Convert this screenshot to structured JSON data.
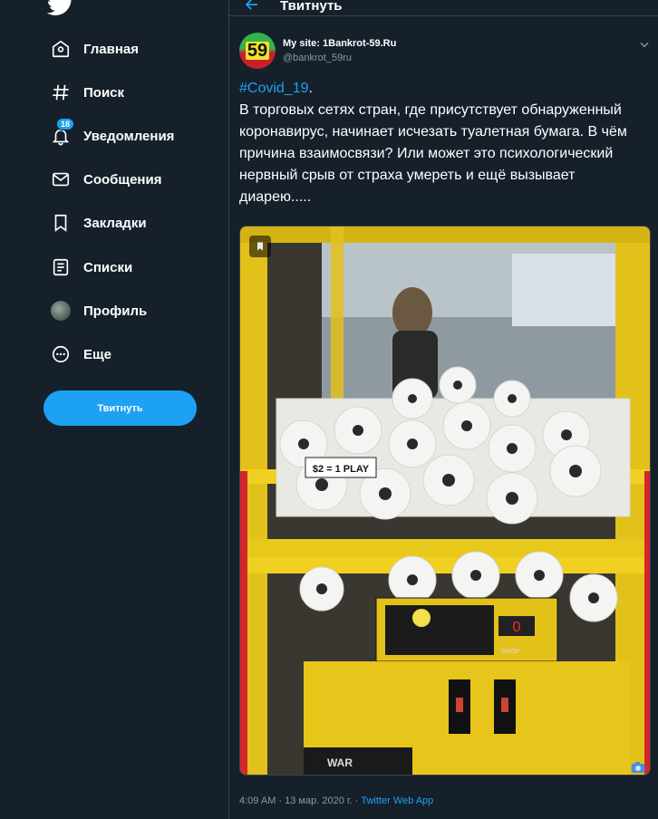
{
  "app": {
    "accent": "#1da1f2",
    "background": "#15202b",
    "muted": "#8899a6",
    "divider": "#38444d"
  },
  "sidebar": {
    "logo_icon": "twitter-bird-icon",
    "items": [
      {
        "label": "Главная",
        "icon": "home-icon"
      },
      {
        "label": "Поиск",
        "icon": "hashtag-icon"
      },
      {
        "label": "Уведомления",
        "icon": "bell-icon",
        "badge": "18"
      },
      {
        "label": "Сообщения",
        "icon": "envelope-icon"
      },
      {
        "label": "Закладки",
        "icon": "bookmark-icon"
      },
      {
        "label": "Списки",
        "icon": "list-icon"
      },
      {
        "label": "Профиль",
        "icon": "avatar-icon"
      },
      {
        "label": "Еще",
        "icon": "more-icon"
      }
    ],
    "tweet_button": "Твитнуть"
  },
  "header": {
    "title": "Твитнуть",
    "back_icon": "arrow-left-icon"
  },
  "tweet": {
    "avatar_text": "59",
    "author_name": "My site: 1Bankrot-59.Ru",
    "author_handle": "@bankrot_59ru",
    "hashtag": "#Covid_19",
    "hashtag_suffix": ".",
    "body": "В торговых сетях стран, где присутствует обнаруженный коронавирус, начинает исчезать туалетная бумага. В чём причина взаимосвязи? Или может это психологический нервный срыв от страха умереть и ещё вызывает диарею.....",
    "image_labels": {
      "sign": "$2 = 1 PLAY",
      "brand": "WAR",
      "counter": "0",
      "button": "DROP"
    },
    "timestamp": "4:09 AM · 13 мар. 2020 г. · ",
    "source": "Twitter Web App"
  }
}
